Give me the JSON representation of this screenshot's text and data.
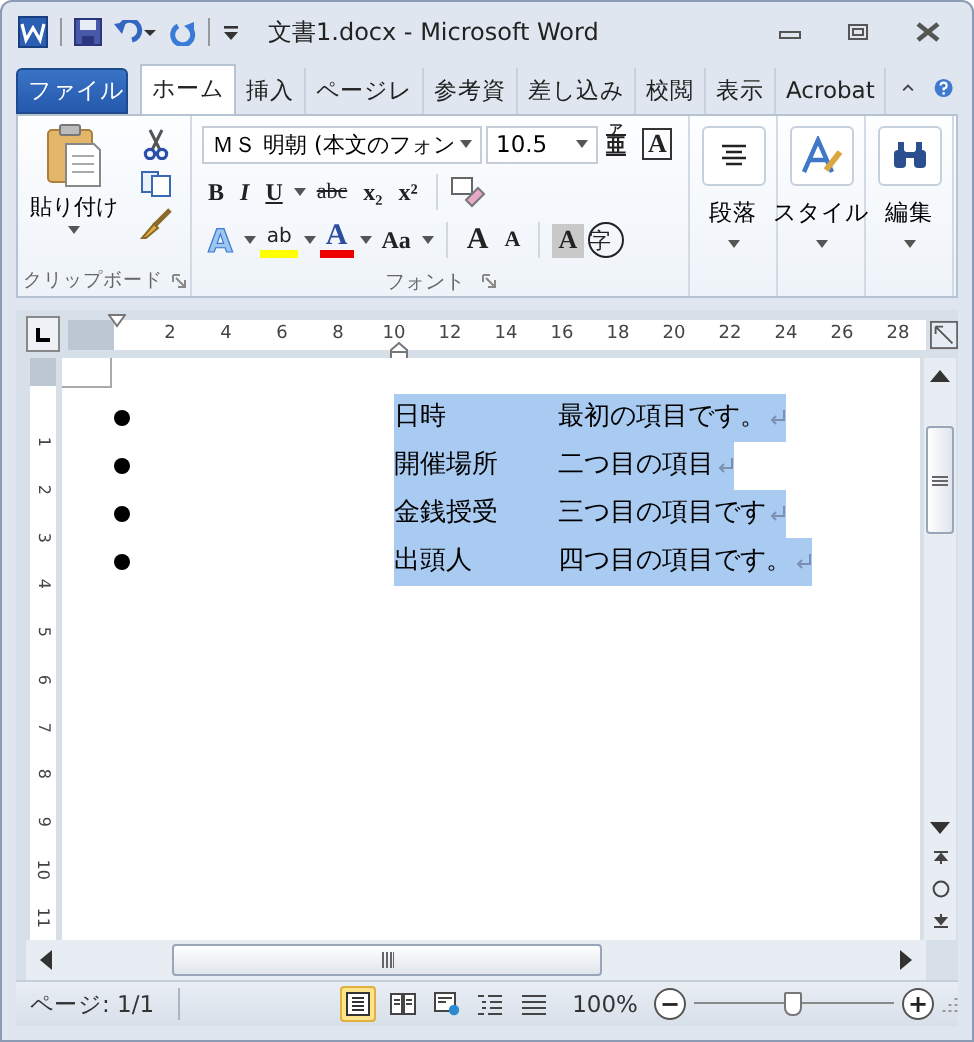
{
  "window": {
    "title": "文書1.docx - Microsoft Word"
  },
  "tabs": [
    {
      "label": "ファイル",
      "kind": "file",
      "selected": false
    },
    {
      "label": "ホーム",
      "kind": "tab",
      "selected": true
    },
    {
      "label": "挿入",
      "kind": "tab",
      "selected": false
    },
    {
      "label": "ページレ",
      "kind": "tab",
      "selected": false
    },
    {
      "label": "参考資",
      "kind": "tab",
      "selected": false
    },
    {
      "label": "差し込み",
      "kind": "tab",
      "selected": false
    },
    {
      "label": "校閲",
      "kind": "tab",
      "selected": false
    },
    {
      "label": "表示",
      "kind": "tab",
      "selected": false
    },
    {
      "label": "Acrobat",
      "kind": "tab",
      "selected": false
    }
  ],
  "clipboard": {
    "paste": "貼り付け",
    "group": "クリップボード"
  },
  "font": {
    "name": "ＭＳ 明朝 (本文のフォン",
    "size": "10.5",
    "ruby": "亜",
    "ruby_top": "ア",
    "border": "A",
    "group": "フォント",
    "row2": [
      {
        "label": "B",
        "kind": "bold",
        "dropdown": false
      },
      {
        "label": "I",
        "kind": "italic",
        "dropdown": false
      },
      {
        "label": "U",
        "kind": "underline",
        "dropdown": true
      },
      {
        "label": "abc",
        "kind": "strike",
        "dropdown": false
      },
      {
        "label": "x₂",
        "kind": "sub",
        "dropdown": false
      },
      {
        "label": "x²",
        "kind": "sup",
        "dropdown": false
      }
    ],
    "row3": [
      {
        "label": "A",
        "kind": "effect",
        "dropdown": true
      },
      {
        "label": "ab",
        "kind": "highlight",
        "dropdown": true
      },
      {
        "label": "A",
        "kind": "color",
        "dropdown": true
      },
      {
        "label": "Aa",
        "kind": "case",
        "dropdown": true
      },
      {
        "label": "A",
        "kind": "grow",
        "dropdown": false
      },
      {
        "label": "A",
        "kind": "shrink",
        "dropdown": false
      },
      {
        "label": "A",
        "kind": "shade",
        "dropdown": false
      },
      {
        "label": "字",
        "kind": "enclose",
        "dropdown": false
      }
    ]
  },
  "big_groups": [
    {
      "label": "段落",
      "kind": "paragraph"
    },
    {
      "label": "スタイル",
      "kind": "style"
    },
    {
      "label": "編集",
      "kind": "edit"
    }
  ],
  "ruler": {
    "labels": [
      "2",
      "4",
      "6",
      "8",
      "10",
      "12",
      "14",
      "16",
      "18",
      "20",
      "22",
      "24",
      "26",
      "28"
    ]
  },
  "vruler": {
    "labels": [
      "1",
      "2",
      "3",
      "4",
      "5",
      "6",
      "7",
      "8",
      "9",
      "10",
      "11"
    ]
  },
  "items": [
    {
      "term": "日時",
      "text": "最初の項目です。",
      "selected": true
    },
    {
      "term": "開催場所",
      "text": "二つ目の項目",
      "selected": true
    },
    {
      "term": "金銭授受",
      "text": "三つ目の項目です",
      "selected": true
    },
    {
      "term": "出頭人",
      "text": "四つ目の項目です。",
      "selected": true
    }
  ],
  "status": {
    "page": "ページ: 1/1",
    "views": [
      {
        "kind": "print",
        "selected": true
      },
      {
        "kind": "reading",
        "selected": false
      },
      {
        "kind": "web",
        "selected": false
      },
      {
        "kind": "outline",
        "selected": false
      },
      {
        "kind": "draft",
        "selected": false
      }
    ],
    "zoom": "100%",
    "zoom_minus": "−",
    "zoom_plus": "+",
    "level": 0.5
  }
}
